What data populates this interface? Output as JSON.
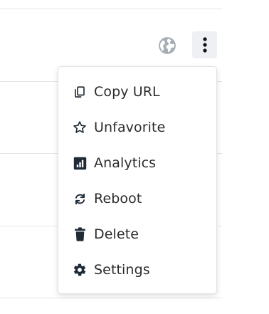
{
  "header": {
    "globe_icon": "globe-icon",
    "more_icon": "more-vertical-icon"
  },
  "menu": {
    "items": [
      {
        "label": "Copy URL",
        "icon": "copy-icon"
      },
      {
        "label": "Unfavorite",
        "icon": "star-outline-icon"
      },
      {
        "label": "Analytics",
        "icon": "analytics-icon"
      },
      {
        "label": "Reboot",
        "icon": "reboot-icon"
      },
      {
        "label": "Delete",
        "icon": "trash-icon"
      },
      {
        "label": "Settings",
        "icon": "gear-icon"
      }
    ]
  },
  "colors": {
    "menu_text": "#2b2b2b",
    "icon_dark": "#1f2a37",
    "globe": "#a7adb5",
    "kebab_bg": "#eef0f3"
  }
}
